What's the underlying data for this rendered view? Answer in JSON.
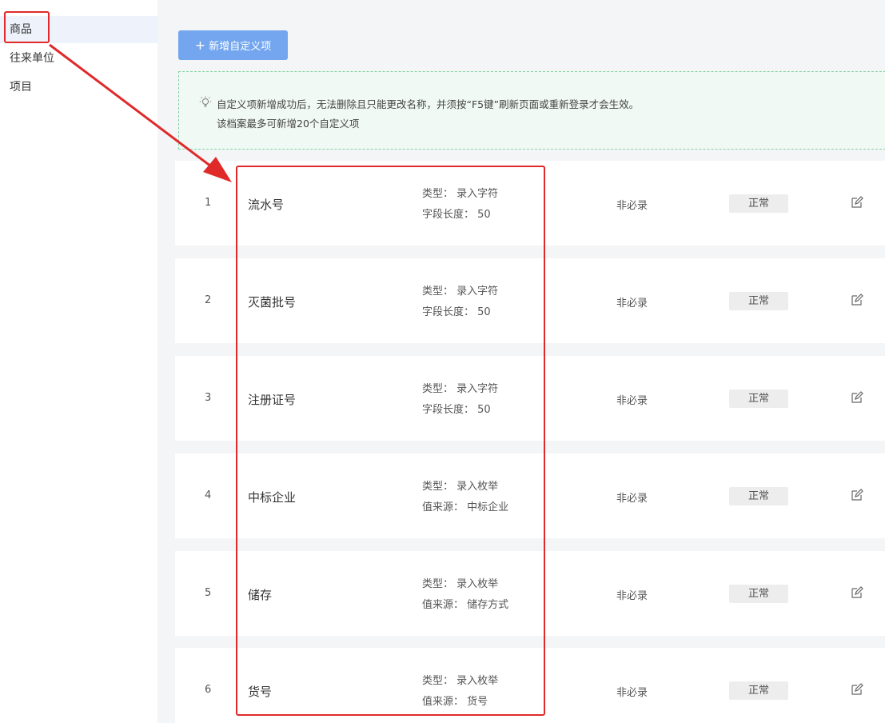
{
  "sidebar": {
    "items": [
      {
        "label": "商品",
        "active": true
      },
      {
        "label": "往来单位",
        "active": false
      },
      {
        "label": "项目",
        "active": false
      }
    ]
  },
  "toolbar": {
    "add_button_icon": "plus-icon",
    "add_button_label": "新增自定义项"
  },
  "tip": {
    "icon": "lightbulb-icon",
    "line1": "自定义项新增成功后，无法删除且只能更改名称，并须按“F5键”刷新页面或重新登录才会生效。",
    "line2": "该档案最多可新增20个自定义项"
  },
  "rows": [
    {
      "index": "1",
      "name": "流水号",
      "info1": "类型：  录入字符",
      "info2": "字段长度：  50",
      "required": "非必录",
      "status": "正常"
    },
    {
      "index": "2",
      "name": "灭菌批号",
      "info1": "类型：  录入字符",
      "info2": "字段长度：  50",
      "required": "非必录",
      "status": "正常"
    },
    {
      "index": "3",
      "name": "注册证号",
      "info1": "类型：  录入字符",
      "info2": "字段长度：  50",
      "required": "非必录",
      "status": "正常"
    },
    {
      "index": "4",
      "name": "中标企业",
      "info1": "类型：  录入枚举",
      "info2": "值来源：  中标企业",
      "required": "非必录",
      "status": "正常"
    },
    {
      "index": "5",
      "name": "储存",
      "info1": "类型：  录入枚举",
      "info2": "值来源：  储存方式",
      "required": "非必录",
      "status": "正常"
    },
    {
      "index": "6",
      "name": "货号",
      "info1": "类型：  录入枚举",
      "info2": "值来源：  货号",
      "required": "非必录",
      "status": "正常"
    }
  ],
  "colors": {
    "accent_button": "#73a6ee",
    "tip_border": "#85d2a4",
    "tip_background": "#f1f9f4",
    "annotation_red": "#e02a2a",
    "status_badge_bg": "#ededed",
    "sidebar_active_bg": "#eef3fb"
  }
}
